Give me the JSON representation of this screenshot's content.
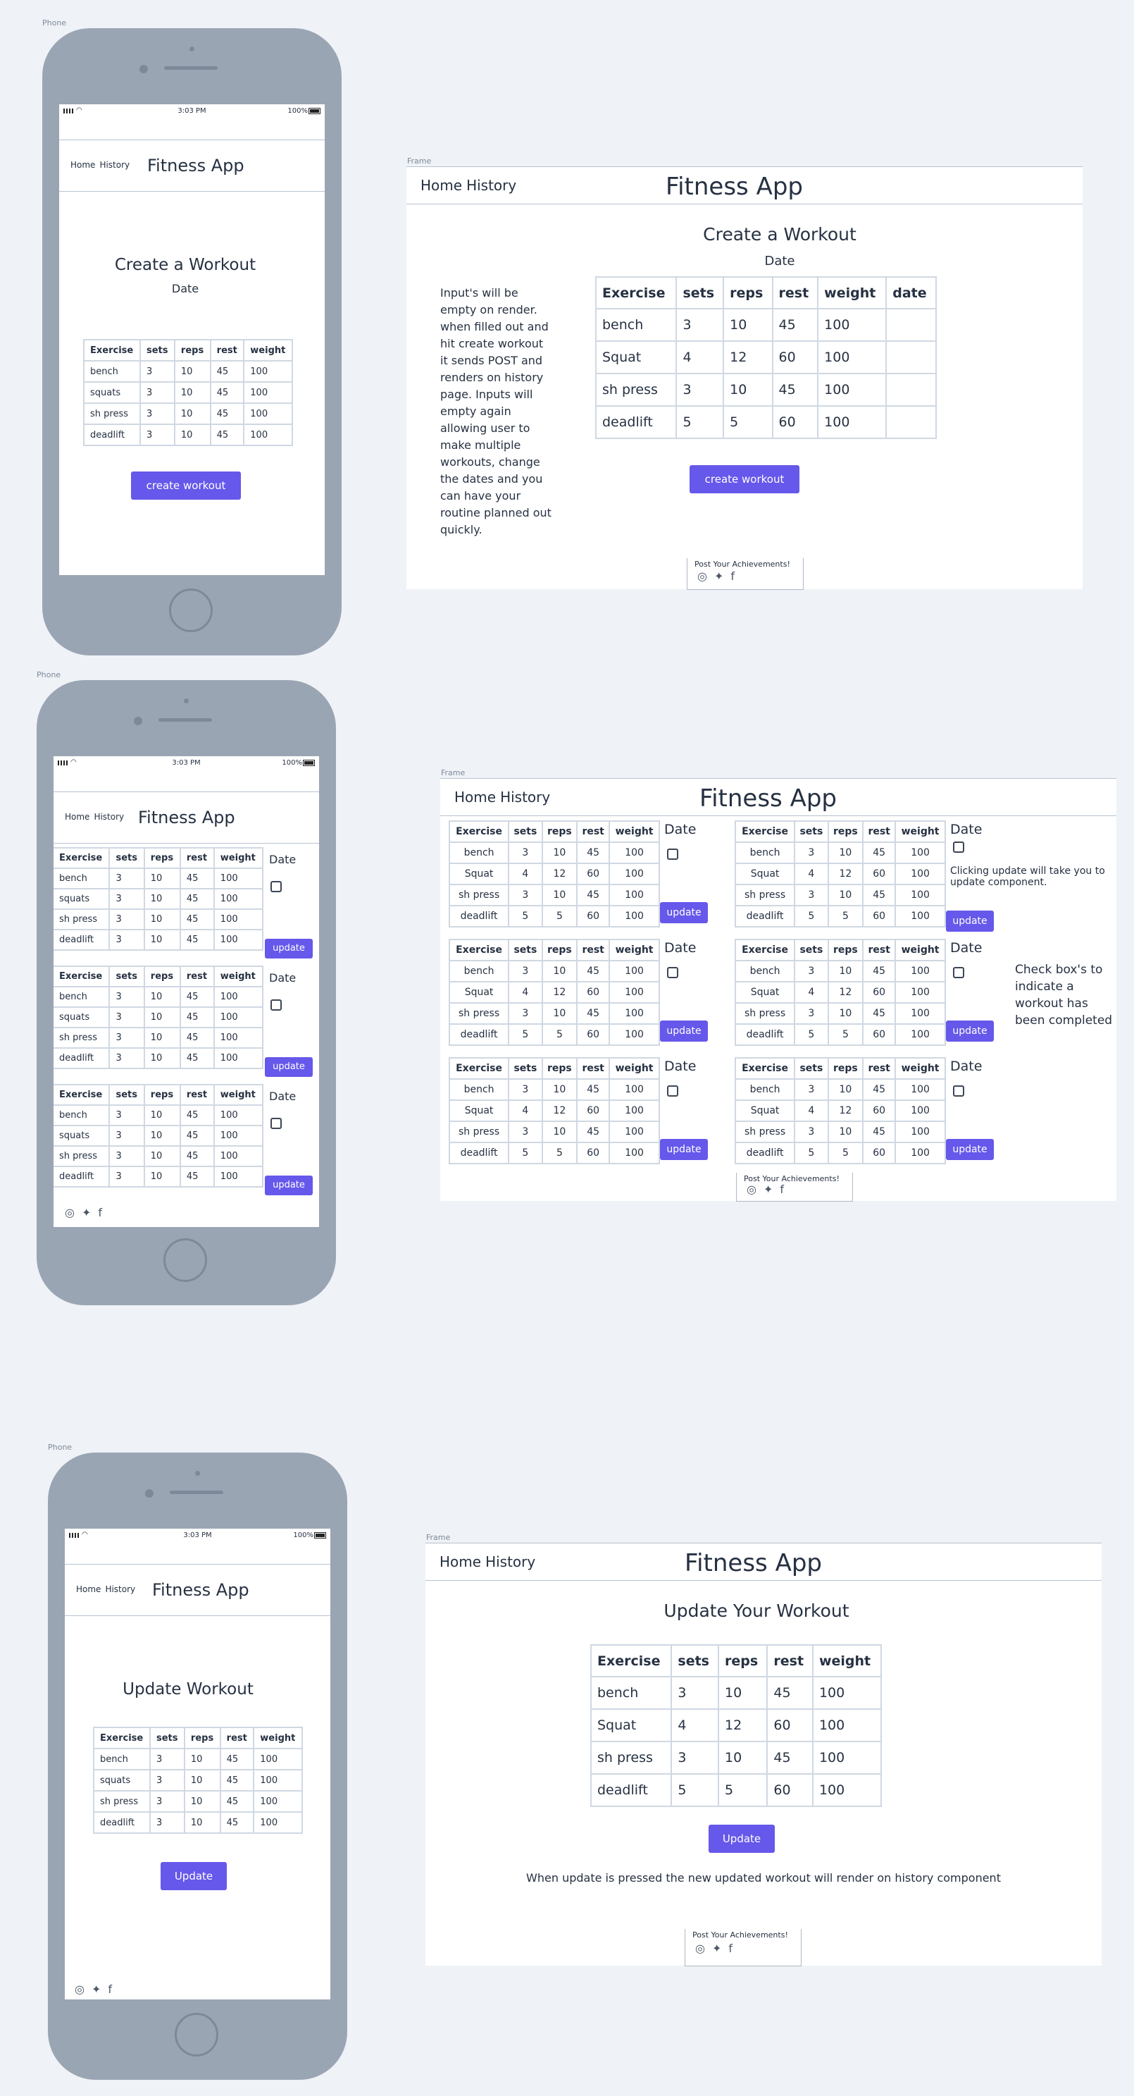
{
  "labels": {
    "phone": "Phone",
    "frame": "Frame"
  },
  "status": {
    "time": "3:03 PM",
    "battery": "100%"
  },
  "nav": {
    "home": "Home",
    "history": "History",
    "app_title": "Fitness App"
  },
  "create": {
    "title": "Create a Workout",
    "date": "Date",
    "button": "create workout",
    "note": "Input's will be empty on render. when filled out and hit create workout it sends POST and renders on history page. Inputs will empty again allowing user to make multiple workouts, change the dates and you can have your routine planned out quickly.",
    "headers": [
      "Exercise",
      "sets",
      "reps",
      "rest",
      "weight"
    ],
    "headers_with_date": [
      "Exercise",
      "sets",
      "reps",
      "rest",
      "weight",
      "date"
    ],
    "phone_rows": [
      [
        "bench",
        "3",
        "10",
        "45",
        "100"
      ],
      [
        "squats",
        "3",
        "10",
        "45",
        "100"
      ],
      [
        "sh press",
        "3",
        "10",
        "45",
        "100"
      ],
      [
        "deadlift",
        "3",
        "10",
        "45",
        "100"
      ]
    ],
    "desktop_rows": [
      [
        "bench",
        "3",
        "10",
        "45",
        "100",
        ""
      ],
      [
        "Squat",
        "4",
        "12",
        "60",
        "100",
        ""
      ],
      [
        "sh press",
        "3",
        "10",
        "45",
        "100",
        ""
      ],
      [
        "deadlift",
        "5",
        "5",
        "60",
        "100",
        ""
      ]
    ]
  },
  "history": {
    "date": "Date",
    "button": "update",
    "note_update": "Clicking update will take you to update component.",
    "note_checkbox": "Check box's to indicate a workout has been completed",
    "phone_rows": [
      [
        "bench",
        "3",
        "10",
        "45",
        "100"
      ],
      [
        "squats",
        "3",
        "10",
        "45",
        "100"
      ],
      [
        "sh press",
        "3",
        "10",
        "45",
        "100"
      ],
      [
        "deadlift",
        "3",
        "10",
        "45",
        "100"
      ]
    ],
    "desktop_rows_a": [
      [
        "bench",
        "3",
        "10",
        "45",
        "100"
      ],
      [
        "Squat",
        "4",
        "12",
        "60",
        "100"
      ],
      [
        "sh press",
        "3",
        "10",
        "45",
        "100"
      ],
      [
        "deadlift",
        "5",
        "5",
        "60",
        "100"
      ]
    ]
  },
  "update": {
    "phone_title": "Update Workout",
    "desktop_title": "Update Your Workout",
    "button": "Update",
    "note": "When update is pressed the new updated workout will render on history component",
    "desktop_rows": [
      [
        "bench",
        "3",
        "10",
        "45",
        "100"
      ],
      [
        "Squat",
        "4",
        "12",
        "60",
        "100"
      ],
      [
        "sh press",
        "3",
        "10",
        "45",
        "100"
      ],
      [
        "deadlift",
        "5",
        "5",
        "60",
        "100"
      ]
    ]
  },
  "footer": {
    "post": "Post Your Achievements!"
  }
}
